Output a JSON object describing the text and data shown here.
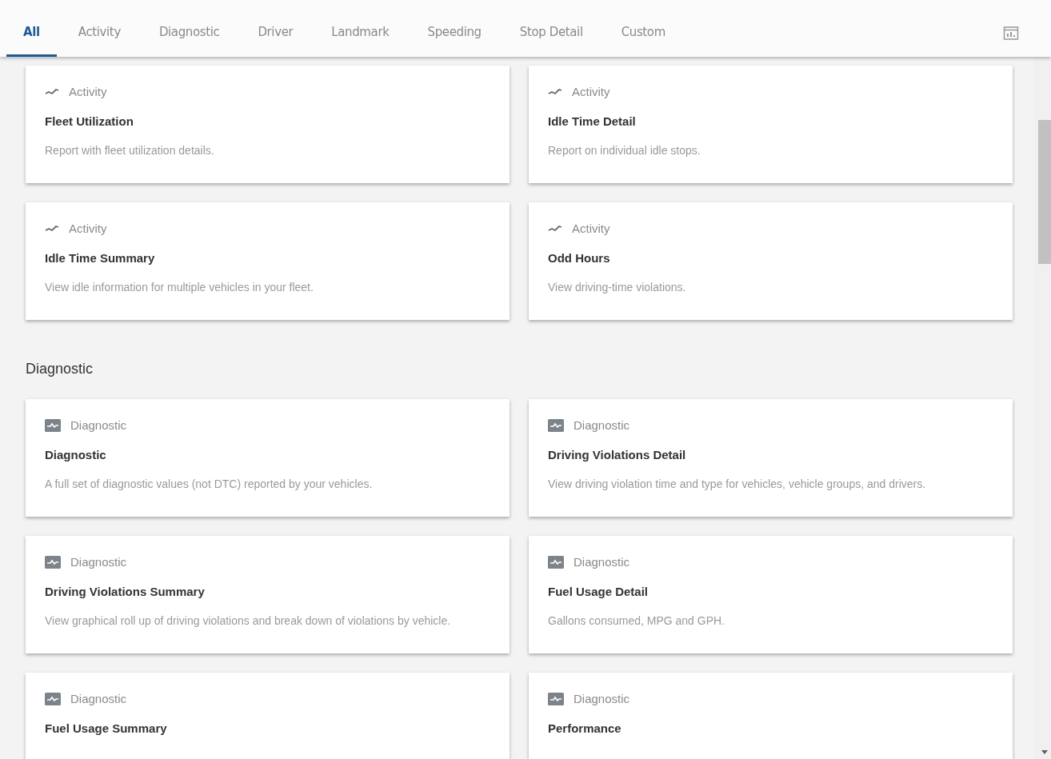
{
  "tabs": [
    {
      "label": "All",
      "selected": true
    },
    {
      "label": "Activity",
      "selected": false
    },
    {
      "label": "Diagnostic",
      "selected": false
    },
    {
      "label": "Driver",
      "selected": false
    },
    {
      "label": "Landmark",
      "selected": false
    },
    {
      "label": "Speeding",
      "selected": false
    },
    {
      "label": "Stop Detail",
      "selected": false
    },
    {
      "label": "Custom",
      "selected": false
    }
  ],
  "sections": [
    {
      "cards": [
        {
          "kind": "activity",
          "category": "Activity",
          "title": "Fleet Utilization",
          "description": "Report with fleet utilization details."
        },
        {
          "kind": "activity",
          "category": "Activity",
          "title": "Idle Time Detail",
          "description": "Report on individual idle stops."
        },
        {
          "kind": "activity",
          "category": "Activity",
          "title": "Idle Time Summary",
          "description": "View idle information for multiple vehicles in your fleet."
        },
        {
          "kind": "activity",
          "category": "Activity",
          "title": "Odd Hours",
          "description": "View driving-time violations."
        }
      ]
    },
    {
      "heading": "Diagnostic",
      "cards": [
        {
          "kind": "diagnostic",
          "category": "Diagnostic",
          "title": "Diagnostic",
          "description": "A full set of diagnostic values (not DTC) reported by your vehicles."
        },
        {
          "kind": "diagnostic",
          "category": "Diagnostic",
          "title": "Driving Violations Detail",
          "description": "View driving violation time and type for vehicles, vehicle groups, and drivers."
        },
        {
          "kind": "diagnostic",
          "category": "Diagnostic",
          "title": "Driving Violations Summary",
          "description": "View graphical roll up of driving violations and break down of violations by vehicle."
        },
        {
          "kind": "diagnostic",
          "category": "Diagnostic",
          "title": "Fuel Usage Detail",
          "description": "Gallons consumed, MPG and GPH."
        },
        {
          "kind": "diagnostic",
          "category": "Diagnostic",
          "title": "Fuel Usage Summary"
        },
        {
          "kind": "diagnostic",
          "category": "Diagnostic",
          "title": "Performance"
        }
      ]
    }
  ]
}
